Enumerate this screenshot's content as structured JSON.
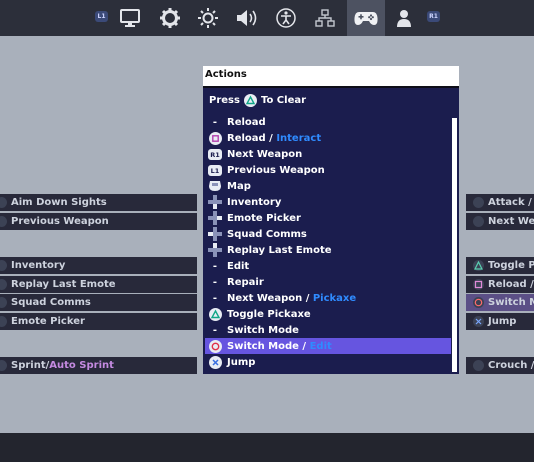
{
  "top_tabs": [
    {
      "badge": "L1"
    },
    {
      "icon": "monitor-icon"
    },
    {
      "icon": "gear-icon"
    },
    {
      "icon": "brightness-icon"
    },
    {
      "icon": "volume-icon"
    },
    {
      "icon": "accessibility-icon"
    },
    {
      "icon": "network-icon"
    },
    {
      "icon": "controller-icon",
      "active": true
    },
    {
      "icon": "account-icon"
    },
    {
      "badge": "R1"
    }
  ],
  "left_rows": [
    {
      "text": "Aim Down Sights"
    },
    {
      "text": "Previous Weapon"
    },
    {
      "text": "Inventory"
    },
    {
      "text": "Replay Last Emote"
    },
    {
      "text": "Squad Comms"
    },
    {
      "text": "Emote Picker"
    },
    {
      "text": "Sprint",
      "sep": " / ",
      "alt": "Auto Sprint"
    }
  ],
  "right_rows": [
    {
      "text": "Attack / "
    },
    {
      "text": "Next Wea"
    },
    {
      "text": "Toggle Pi"
    },
    {
      "text": "Reload / "
    },
    {
      "text": "Switch M"
    },
    {
      "text": "Jump"
    },
    {
      "text": "Crouch / "
    }
  ],
  "popup": {
    "title": "Actions",
    "press_label": "Press",
    "press_suffix": "To Clear",
    "items": [
      {
        "icon": "dash",
        "label": "Reload"
      },
      {
        "icon": "square-button-icon",
        "label": "Reload",
        "sep": " / ",
        "alt": "Interact"
      },
      {
        "icon": "r1-button-icon",
        "label": "Next Weapon"
      },
      {
        "icon": "l1-button-icon",
        "label": "Previous Weapon"
      },
      {
        "icon": "touchpad-icon",
        "label": "Map"
      },
      {
        "icon": "dpad-down-icon",
        "label": "Inventory"
      },
      {
        "icon": "dpad-right-icon",
        "label": "Emote Picker"
      },
      {
        "icon": "dpad-left-icon",
        "label": "Squad Comms"
      },
      {
        "icon": "dpad-up-icon",
        "label": "Replay Last Emote"
      },
      {
        "icon": "dash",
        "label": "Edit"
      },
      {
        "icon": "dash",
        "label": "Repair"
      },
      {
        "icon": "dash",
        "label": "Next Weapon",
        "sep": " / ",
        "alt": "Pickaxe"
      },
      {
        "icon": "triangle-button-icon",
        "label": "Toggle Pickaxe"
      },
      {
        "icon": "dash",
        "label": "Switch Mode"
      },
      {
        "icon": "circle-button-icon",
        "label": "Switch Mode",
        "sep": " / ",
        "alt": "Edit",
        "selected": true
      },
      {
        "icon": "cross-button-icon",
        "label": "Jump"
      }
    ]
  },
  "colors": {
    "popup_bg": "#1b1d4e",
    "selected": "#6655e0",
    "alt_text": "#2f8bff",
    "accent_purple": "#c48ae0"
  }
}
